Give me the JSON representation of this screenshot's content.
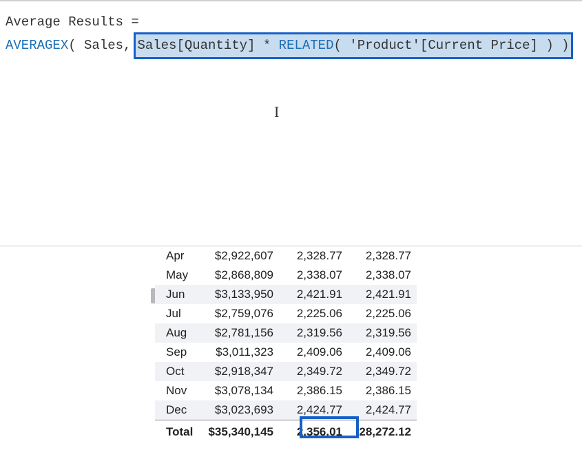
{
  "formula": {
    "line1": "Average Results =",
    "func1": "AVERAGEX",
    "open_args": "( Sales,",
    "highlight_part1": "Sales[Quantity] * ",
    "highlight_func": "RELATED",
    "highlight_part2": "( 'Product'[Current Price] ) )"
  },
  "cursor_glyph": "I",
  "table": {
    "rows": [
      {
        "month": "Apr",
        "amount": "$2,922,607",
        "val1": "2,328.77",
        "val2": "2,328.77",
        "alt": false
      },
      {
        "month": "May",
        "amount": "$2,868,809",
        "val1": "2,338.07",
        "val2": "2,338.07",
        "alt": false
      },
      {
        "month": "Jun",
        "amount": "$3,133,950",
        "val1": "2,421.91",
        "val2": "2,421.91",
        "alt": true
      },
      {
        "month": "Jul",
        "amount": "$2,759,076",
        "val1": "2,225.06",
        "val2": "2,225.06",
        "alt": false
      },
      {
        "month": "Aug",
        "amount": "$2,781,156",
        "val1": "2,319.56",
        "val2": "2,319.56",
        "alt": true
      },
      {
        "month": "Sep",
        "amount": "$3,011,323",
        "val1": "2,409.06",
        "val2": "2,409.06",
        "alt": false
      },
      {
        "month": "Oct",
        "amount": "$2,918,347",
        "val1": "2,349.72",
        "val2": "2,349.72",
        "alt": true
      },
      {
        "month": "Nov",
        "amount": "$3,078,134",
        "val1": "2,386.15",
        "val2": "2,386.15",
        "alt": false
      },
      {
        "month": "Dec",
        "amount": "$3,023,693",
        "val1": "2,424.77",
        "val2": "2,424.77",
        "alt": true
      }
    ],
    "total": {
      "label": "Total",
      "amount": "$35,340,145",
      "val1": "2,356.01",
      "val2": "28,272.12"
    }
  }
}
